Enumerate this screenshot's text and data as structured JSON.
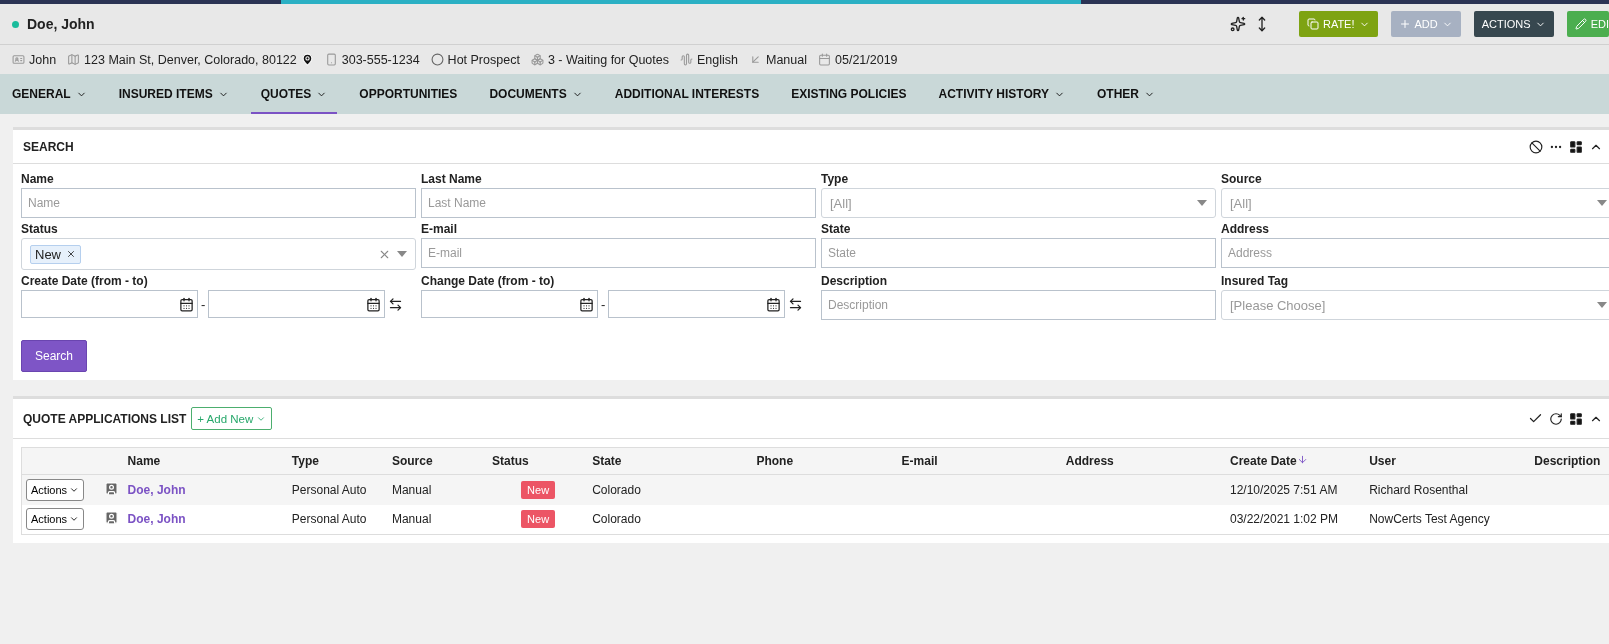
{
  "header": {
    "name": "Doe, John",
    "buttons": [
      {
        "kind": "rate",
        "label": "RATE!",
        "dropdown": true
      },
      {
        "kind": "add",
        "label": "ADD",
        "dropdown": true
      },
      {
        "kind": "actions",
        "label": "ACTIONS",
        "dropdown": true
      },
      {
        "kind": "edit",
        "label": "EDI",
        "dropdown": false
      }
    ]
  },
  "info": [
    {
      "kind": "id",
      "text": "John"
    },
    {
      "kind": "address",
      "text": "123 Main St, Denver, Colorado, 80122"
    },
    {
      "kind": "phone",
      "text": "303-555-1234"
    },
    {
      "kind": "prospect",
      "text": "Hot Prospect"
    },
    {
      "kind": "stage",
      "text": "3 - Waiting for Quotes"
    },
    {
      "kind": "language",
      "text": "English"
    },
    {
      "kind": "source",
      "text": "Manual"
    },
    {
      "kind": "date",
      "text": "05/21/2019"
    }
  ],
  "tabs": [
    {
      "label": "GENERAL",
      "dropdown": true,
      "selected": false
    },
    {
      "label": "INSURED ITEMS",
      "dropdown": true,
      "selected": false
    },
    {
      "label": "QUOTES",
      "dropdown": true,
      "selected": true
    },
    {
      "label": "OPPORTUNITIES",
      "dropdown": false,
      "selected": false
    },
    {
      "label": "DOCUMENTS",
      "dropdown": true,
      "selected": false
    },
    {
      "label": "ADDITIONAL INTERESTS",
      "dropdown": false,
      "selected": false
    },
    {
      "label": "EXISTING POLICIES",
      "dropdown": false,
      "selected": false
    },
    {
      "label": "ACTIVITY HISTORY",
      "dropdown": true,
      "selected": false
    },
    {
      "label": "OTHER",
      "dropdown": true,
      "selected": false
    }
  ],
  "search": {
    "title": "SEARCH",
    "button": "Search",
    "fields": [
      {
        "label": "Name",
        "kind": "text",
        "placeholder": "Name"
      },
      {
        "label": "Last Name",
        "kind": "text",
        "placeholder": "Last Name"
      },
      {
        "label": "Type",
        "kind": "select",
        "placeholder": "[All]"
      },
      {
        "label": "Source",
        "kind": "select",
        "placeholder": "[All]"
      },
      {
        "label": "Status",
        "kind": "tags",
        "tags": [
          "New"
        ]
      },
      {
        "label": "E-mail",
        "kind": "text",
        "placeholder": "E-mail"
      },
      {
        "label": "State",
        "kind": "text",
        "placeholder": "State"
      },
      {
        "label": "Address",
        "kind": "text",
        "placeholder": "Address"
      },
      {
        "label": "Create Date (from - to)",
        "kind": "daterange",
        "separator": "-"
      },
      {
        "label": "Change Date (from - to)",
        "kind": "daterange",
        "separator": "-"
      },
      {
        "label": "Description",
        "kind": "text",
        "placeholder": "Description"
      },
      {
        "label": "Insured Tag",
        "kind": "select",
        "placeholder": "[Please Choose]"
      }
    ]
  },
  "list": {
    "title": "QUOTE APPLICATIONS LIST",
    "add_new": "+ Add New",
    "columns": [
      {
        "sorted": false
      },
      {
        "sorted": false
      },
      {
        "label": "Name",
        "sorted": false
      },
      {
        "label": "Type",
        "sorted": false
      },
      {
        "label": "Source",
        "sorted": false
      },
      {
        "label": "Status",
        "sorted": false
      },
      {
        "label": "State",
        "sorted": false
      },
      {
        "label": "Phone",
        "sorted": false
      },
      {
        "label": "E-mail",
        "sorted": false
      },
      {
        "label": "Address",
        "sorted": false
      },
      {
        "label": "Create Date",
        "sorted": true
      },
      {
        "label": "User",
        "sorted": false
      },
      {
        "label": "Description",
        "sorted": false
      }
    ],
    "rows": [
      {
        "actions": "Actions",
        "name": "Doe, John",
        "type": "Personal Auto",
        "source": "Manual",
        "status": "New",
        "state": "Colorado",
        "create_date": "12/10/2025 7:51 AM",
        "user": "Richard Rosenthal"
      },
      {
        "actions": "Actions",
        "name": "Doe, John",
        "type": "Personal Auto",
        "source": "Manual",
        "status": "New",
        "state": "Colorado",
        "create_date": "03/22/2021 1:02 PM",
        "user": "NowCerts Test Agency"
      }
    ]
  }
}
